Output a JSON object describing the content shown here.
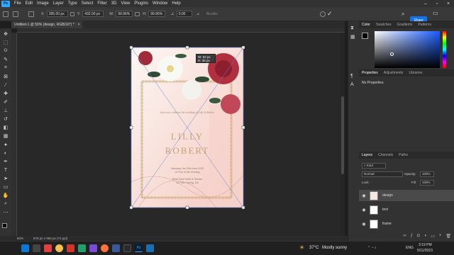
{
  "menu": {
    "app_logo": "Ps",
    "items": [
      "File",
      "Edit",
      "Image",
      "Layer",
      "Type",
      "Select",
      "Filter",
      "3D",
      "View",
      "Plugins",
      "Window",
      "Help"
    ]
  },
  "options": {
    "x_label": "X:",
    "x_value": "395.00 px",
    "y_label": "Y:",
    "y_value": "432.00 px",
    "w_label": "W:",
    "w_value": "99.96%",
    "h_label": "H:",
    "h_value": "99.96%",
    "angle_value": "0.00",
    "interp": "Bicubic",
    "share_label": "Share"
  },
  "document": {
    "tab_title": "Untitled-1 @ 50% (design, RGB/16*) *",
    "transform_readout_w": "W: 52 px",
    "transform_readout_h": "H: 46 px",
    "invite_small": "Join us to celebrate the wedding of Lilly & Robert",
    "name1": "LILLY",
    "name2": "ROBERT",
    "date_line1": "Saturday, the 20th June 2020",
    "date_line2": "at Four in the evening",
    "venue_line1": "Bella Vista Hotel & Terrace",
    "venue_line2": "12 Palm Spring, CA"
  },
  "status": {
    "zoom": "50%",
    "doc_size": "678 px x 960 px (72 ppi)"
  },
  "panels": {
    "color_tabs": [
      "Color",
      "Swatches",
      "Gradients",
      "Patterns"
    ],
    "props_tabs": [
      "Properties",
      "Adjustments",
      "Libraries"
    ],
    "props_text": "No Properties",
    "layers_tabs": [
      "Layers",
      "Channels",
      "Paths"
    ],
    "kind_label": "Kind",
    "blend_mode": "Normal",
    "opacity_label": "Opacity:",
    "opacity_value": "100%",
    "lock_label": "Lock:",
    "fill_label": "Fill:",
    "fill_value": "100%",
    "layers": [
      {
        "name": "design"
      },
      {
        "name": "text"
      },
      {
        "name": "frame"
      }
    ],
    "colors": {
      "fg": "#000000",
      "bg": "#ffffff"
    }
  },
  "taskbar": {
    "weather_temp": "37°C",
    "weather_text": "Mostly sunny",
    "lang": "ENG",
    "time": "3:19 PM",
    "date": "5/11/2023"
  }
}
